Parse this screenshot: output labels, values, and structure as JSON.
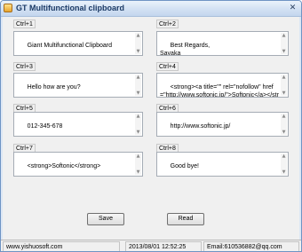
{
  "window": {
    "title": "GT  Multifunctional clipboard",
    "close_glyph": "✕"
  },
  "slots": [
    {
      "label": "Ctrl+1",
      "text": "Giant Multifunctional Clipboard"
    },
    {
      "label": "Ctrl+2",
      "text": "Best Regards,\nSayaka"
    },
    {
      "label": "Ctrl+3",
      "text": "Hello how are you?"
    },
    {
      "label": "Ctrl+4",
      "text": "<strong><a title=\"\" rel=\"nofollow\" href=\"http://www.softonic.jp/\">Softonic</a></strong>"
    },
    {
      "label": "Ctrl+5",
      "text": "012-345-678"
    },
    {
      "label": "Ctrl+6",
      "text": "http://www.softonic.jp/"
    },
    {
      "label": "Ctrl+7",
      "text": "<strong>Softonic</strong>"
    },
    {
      "label": "Ctrl+8",
      "text": "Good bye!"
    }
  ],
  "buttons": {
    "save": "Save",
    "read": "Read"
  },
  "status": {
    "website": "www.yishuosoft.com",
    "datetime": "2013/08/01 12:52:25",
    "email": "Email:610536882@qq.com"
  },
  "icons": {
    "scroll_up": "▲",
    "scroll_down": "▼"
  }
}
